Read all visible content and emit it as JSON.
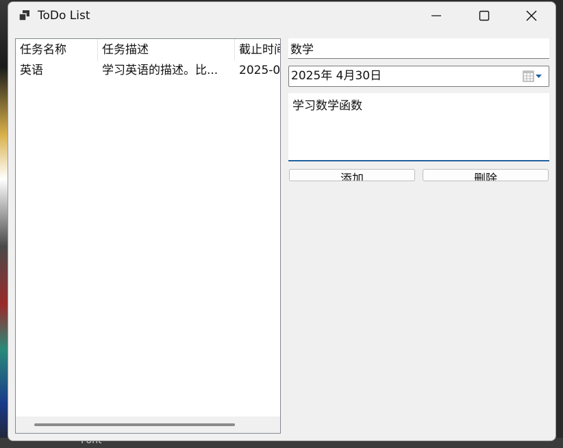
{
  "window": {
    "title": "ToDo List"
  },
  "list": {
    "columns": [
      "任务名称",
      "任务描述",
      "截止时间"
    ],
    "rows": [
      {
        "name": "英语",
        "description": "学习英语的描述。比...",
        "deadline": "2025-0"
      }
    ]
  },
  "form": {
    "name_value": "数学",
    "date_value": "2025年  4月30日",
    "description_value": "学习数学函数",
    "add_label": "添加",
    "delete_label": "删除"
  },
  "background": {
    "partial_text": "Font"
  },
  "colors": {
    "accent": "#1f5f9e",
    "window_bg": "#f0f0f0"
  }
}
